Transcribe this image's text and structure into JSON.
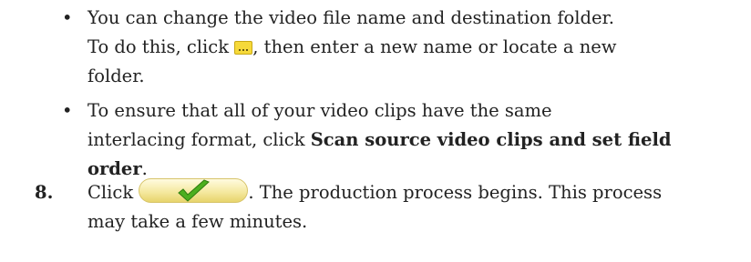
{
  "bullets": [
    {
      "line1": "You can change the video file name and destination folder.",
      "before_icon": "To do this, click ",
      "icon": "browse-ellipsis-icon",
      "after_icon": ", then enter a new name or locate a new",
      "line3": "folder."
    },
    {
      "line1": "To ensure that all of your video clips have the same",
      "line2_plain": "interlacing format, click ",
      "line2_bold": "Scan source video clips and set field",
      "line3_bold": "order",
      "line3_plain": "."
    }
  ],
  "step": {
    "number": "8.",
    "click_label": "Click ",
    "icon": "green-checkmark-ok-icon",
    "after_icon": ". The production process begins. This process",
    "line2": "may take a few minutes."
  },
  "colors": {
    "text": "#222222",
    "checkmark": "#4caf1f",
    "button_fill": "#f5e9a1",
    "browse_icon_fill": "#f6d93a"
  }
}
